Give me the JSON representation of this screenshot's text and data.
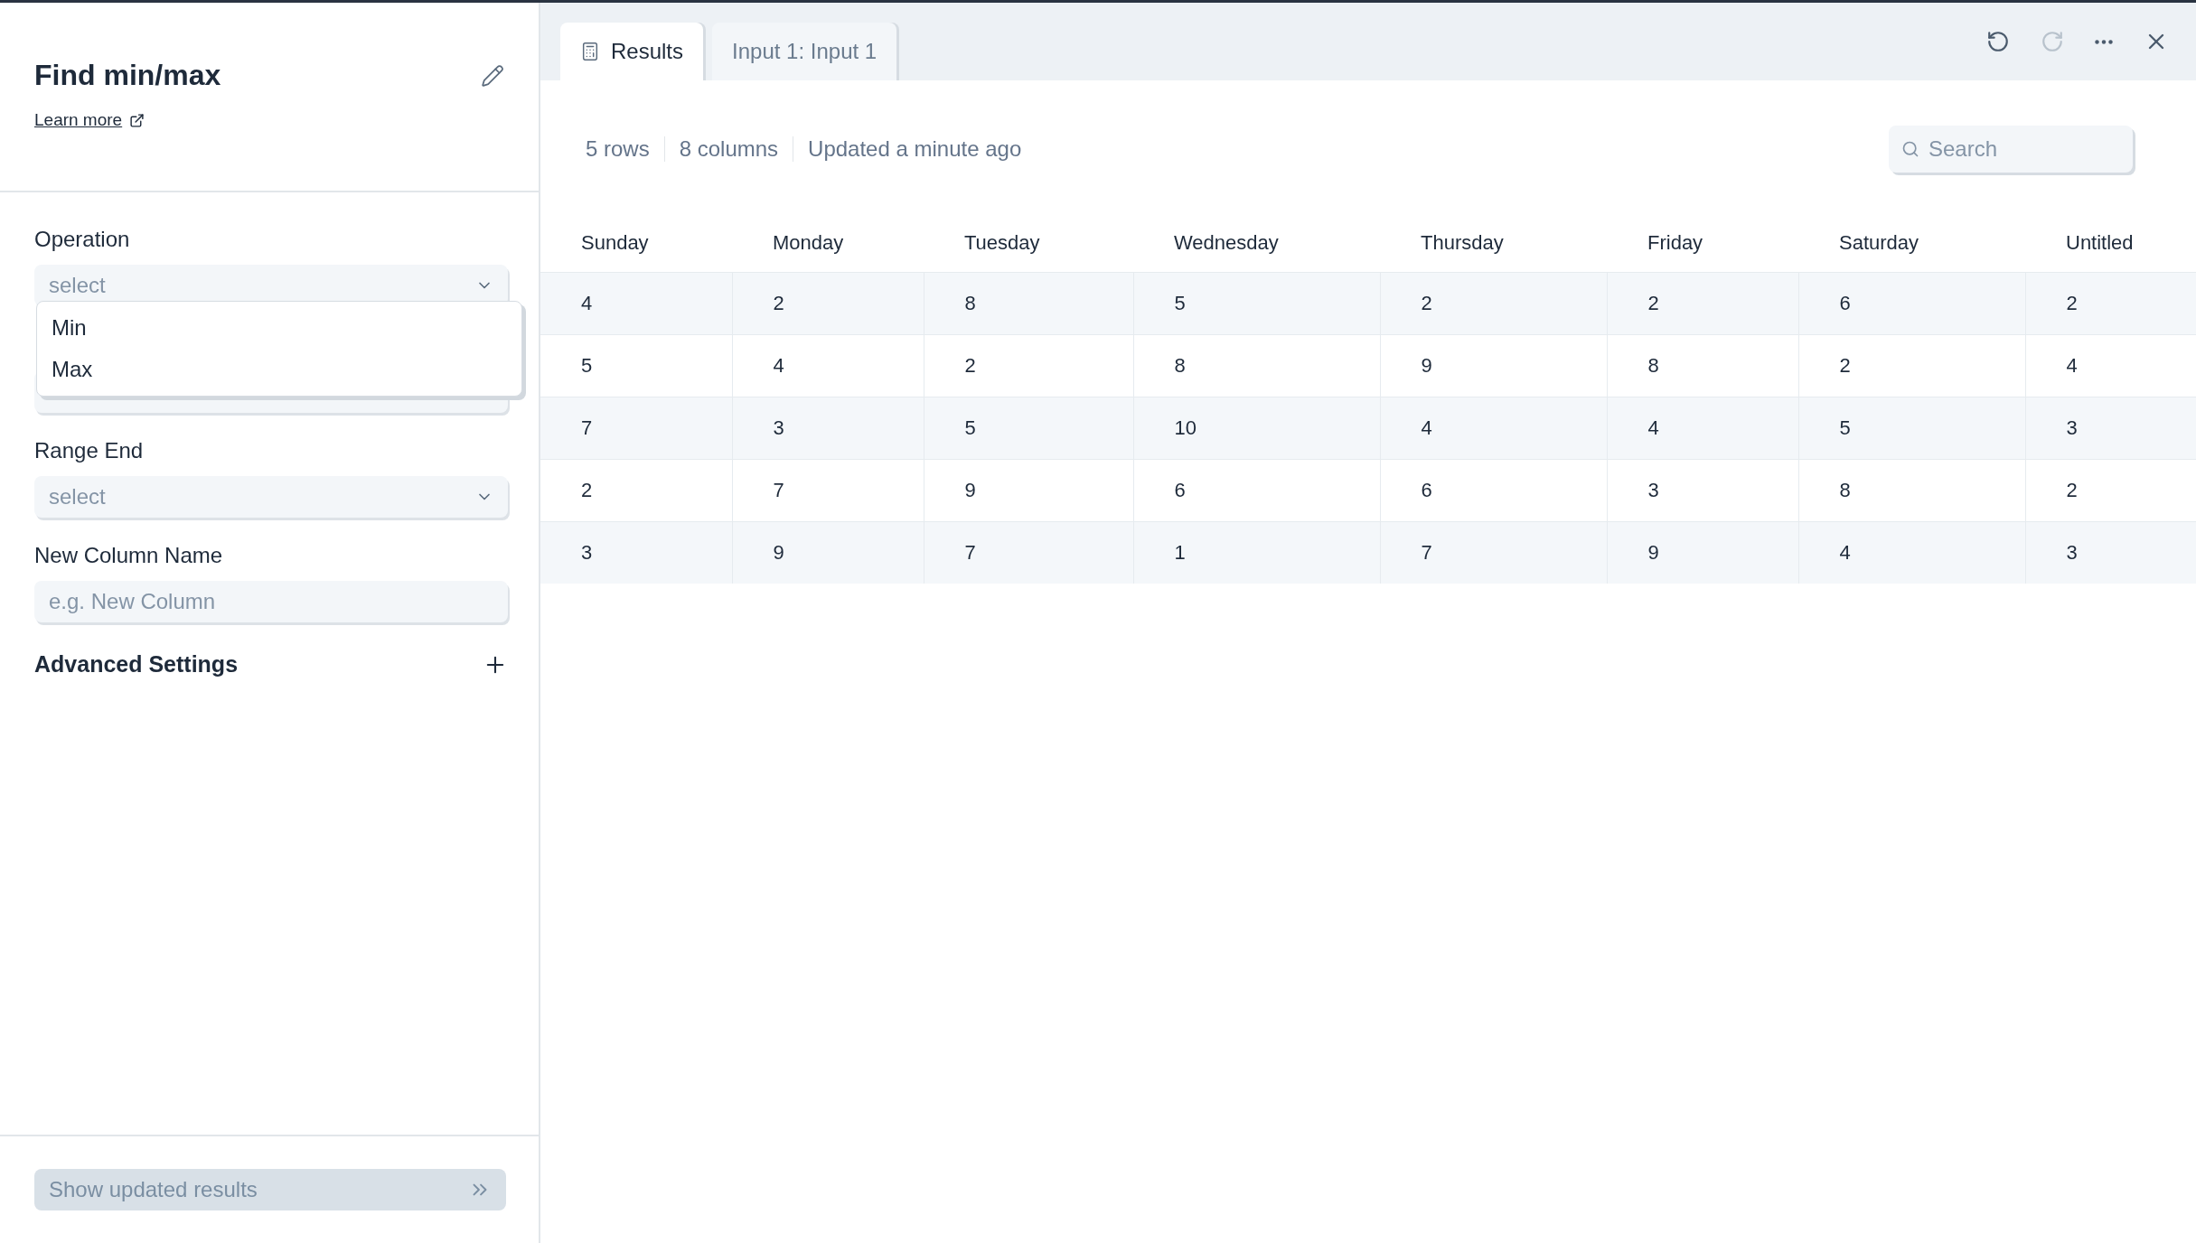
{
  "panel": {
    "title": "Find min/max",
    "learn_more": "Learn more",
    "fields": [
      {
        "label": "Operation",
        "kind": "select",
        "placeholder": "select",
        "open": true,
        "options": [
          "Min",
          "Max"
        ]
      },
      {
        "kind": "select"
      },
      {
        "label": "Range End",
        "kind": "select",
        "placeholder": "select"
      },
      {
        "label": "New Column Name",
        "kind": "text",
        "placeholder": "e.g. New Column"
      }
    ],
    "advanced": "Advanced Settings",
    "submit": {
      "label": "Show updated results",
      "disabled": true
    }
  },
  "tabs": [
    {
      "label": "Results",
      "selected": true
    },
    {
      "label": "Input 1: Input 1",
      "selected": false
    }
  ],
  "toolbar": {
    "undo": {
      "disabled": false
    },
    "redo": {
      "disabled": true
    }
  },
  "summary": [
    "5 rows",
    "8 columns",
    "Updated a minute ago"
  ],
  "search": {
    "placeholder": "Search"
  },
  "table": {
    "columns": [
      "Sunday",
      "Monday",
      "Tuesday",
      "Wednesday",
      "Thursday",
      "Friday",
      "Saturday",
      "Untitled"
    ],
    "rows": [
      [
        "4",
        "2",
        "8",
        "5",
        "2",
        "2",
        "6",
        "2"
      ],
      [
        "5",
        "4",
        "2",
        "8",
        "9",
        "8",
        "2",
        "4"
      ],
      [
        "7",
        "3",
        "5",
        "10",
        "4",
        "4",
        "5",
        "3"
      ],
      [
        "2",
        "7",
        "9",
        "6",
        "6",
        "3",
        "8",
        "2"
      ],
      [
        "3",
        "9",
        "7",
        "1",
        "7",
        "9",
        "4",
        "3"
      ]
    ]
  }
}
